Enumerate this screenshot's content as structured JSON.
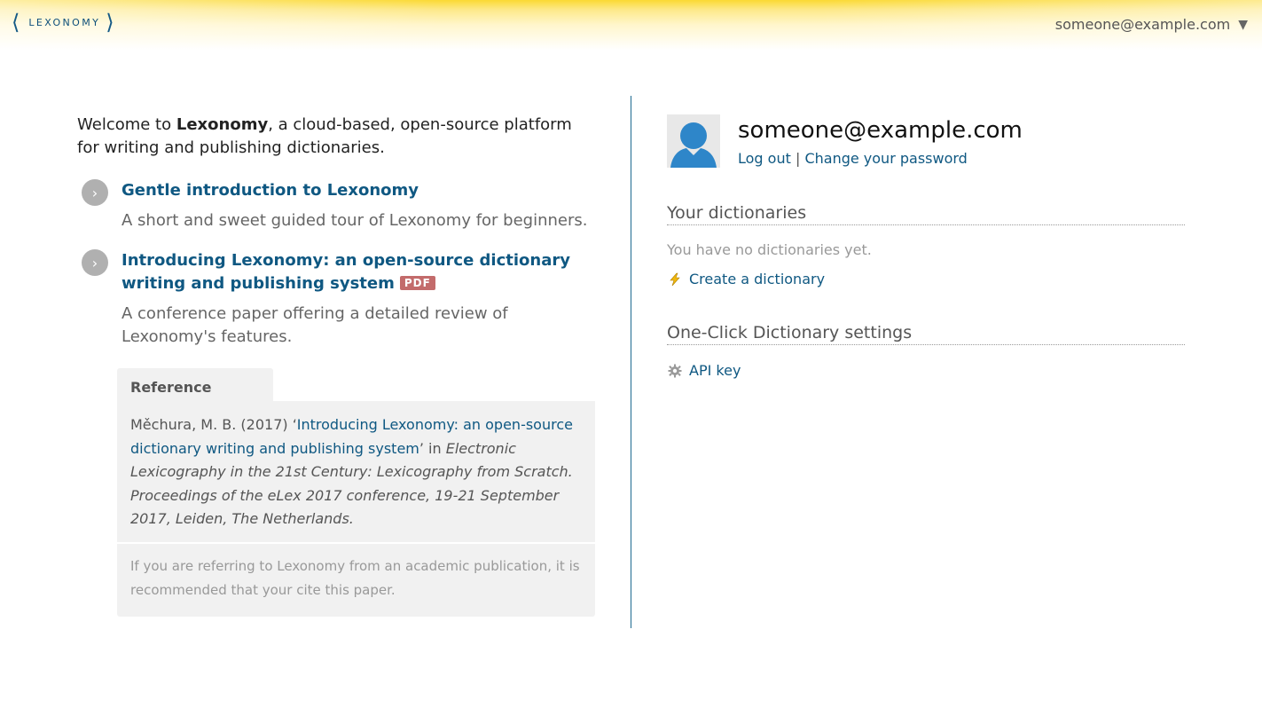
{
  "header": {
    "logo_text": "LEXONOMY",
    "user_email": "someone@example.com",
    "menu_caret": "▼"
  },
  "intro": {
    "prefix": "Welcome to ",
    "brand": "Lexonomy",
    "suffix": ", a cloud-based, open-source platform for writing and publishing dictionaries."
  },
  "resources": [
    {
      "title": "Gentle introduction to Lexonomy",
      "description": "A short and sweet guided tour of Lexonomy for beginners."
    },
    {
      "title": "Introducing Lexonomy: an open-source dictionary writing and publishing system",
      "badge": "PDF",
      "description": "A conference paper offering a detailed review of Lexonomy's features."
    }
  ],
  "reference": {
    "tab_label": "Reference",
    "authors": "Měchura, M. B. (2017) ‘",
    "paper_title": "Introducing Lexonomy: an open-source dictionary writing and publishing system",
    "after_title": "’ in ",
    "venue": "Electronic Lexicography in the 21st Century: Lexicography from Scratch. Proceedings of the eLex 2017 conference, 19-21 September 2017, Leiden, The Netherlands.",
    "note": "If you are referring to Lexonomy from an academic publication, it is recommended that your cite this paper."
  },
  "account": {
    "email": "someone@example.com",
    "logout": "Log out",
    "separator": "|",
    "change_password": "Change your password"
  },
  "dictionaries": {
    "heading": "Your dictionaries",
    "empty_text": "You have no dictionaries yet.",
    "create_label": "Create a dictionary"
  },
  "oneclick": {
    "heading": "One-Click Dictionary settings",
    "api_key_label": "API key"
  },
  "colors": {
    "link": "#0f5882",
    "header_yellow": "#fbd932",
    "pdf_badge": "#c36b6b",
    "divider": "#1e6a91",
    "avatar_blue": "#2e86c9"
  }
}
